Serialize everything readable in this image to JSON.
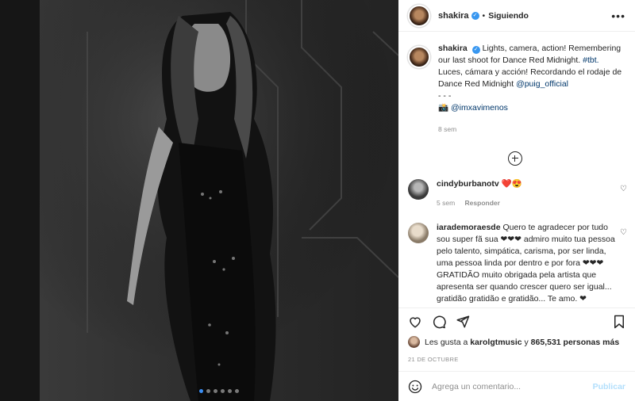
{
  "header": {
    "username": "shakira",
    "separator": "•",
    "follow_label": "Siguiendo",
    "more_label": "•••"
  },
  "caption": {
    "username": "shakira",
    "text": "Lights, camera, action! Remembering our last shoot for Dance Red Midnight.",
    "hashtag": "#tbt.",
    "text2": "Luces, cámara y acción! Recordando el rodaje de Dance Red Midnight",
    "mention": "@puig_official",
    "dashes": "- - -",
    "camera_emoji": "📸",
    "credit": "@imxavimenos",
    "time": "8 sem"
  },
  "comments": [
    {
      "username": "cindyburbanotv",
      "text": "❤️😍",
      "time": "5 sem",
      "reply_label": "Responder"
    },
    {
      "username": "iarademoraesde",
      "text": "Quero te agradecer por tudo sou super fã sua ❤❤❤ admiro muito tua pessoa pelo talento, simpática, carisma, por ser linda, uma pessoa linda por dentro e por fora ❤❤❤ GRATIDÃO muito obrigada pela artista que apresenta ser quando crescer quero ser igual... gratidão gratidão e gratidão... Te amo. ❤"
    }
  ],
  "likes": {
    "prefix": "Les gusta a",
    "user": "karolgtmusic",
    "middle": "y",
    "count": "865,531 personas más"
  },
  "date": "21 DE OCTUBRE",
  "comment_input": {
    "placeholder": "Agrega un comentario...",
    "publish_label": "Publicar"
  },
  "carousel": {
    "next_label": "›",
    "slide_count": 6,
    "active_index": 0
  },
  "icons": [
    "verified-icon",
    "more-icon",
    "add-comment-icon",
    "heart-icon",
    "comment-icon",
    "share-icon",
    "bookmark-icon",
    "emoji-icon",
    "chevron-right-icon"
  ]
}
